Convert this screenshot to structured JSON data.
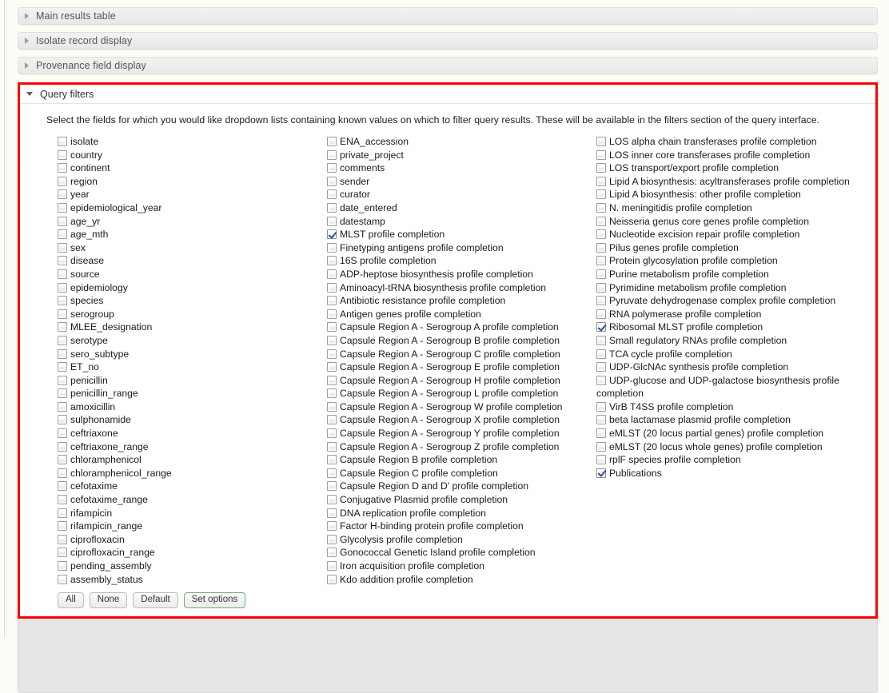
{
  "accordion": {
    "collapsed_sections": [
      {
        "label": "Main results table",
        "icon": "triangle-right-icon"
      },
      {
        "label": "Isolate record display",
        "icon": "triangle-right-icon"
      },
      {
        "label": "Provenance field display",
        "icon": "triangle-right-icon"
      }
    ],
    "expanded_section": {
      "label": "Query filters",
      "icon": "triangle-down-icon",
      "description": "Select the fields for which you would like dropdown lists containing known values on which to filter query results. These will be available in the filters section of the query interface.",
      "highlight_color": "#ff0000"
    }
  },
  "checkbox_columns": [
    {
      "name": "provenance-fields-column",
      "items": [
        {
          "label": "isolate",
          "checked": false
        },
        {
          "label": "country",
          "checked": false
        },
        {
          "label": "continent",
          "checked": false
        },
        {
          "label": "region",
          "checked": false
        },
        {
          "label": "year",
          "checked": false
        },
        {
          "label": "epidemiological_year",
          "checked": false
        },
        {
          "label": "age_yr",
          "checked": false
        },
        {
          "label": "age_mth",
          "checked": false
        },
        {
          "label": "sex",
          "checked": false
        },
        {
          "label": "disease",
          "checked": false
        },
        {
          "label": "source",
          "checked": false
        },
        {
          "label": "epidemiology",
          "checked": false
        },
        {
          "label": "species",
          "checked": false
        },
        {
          "label": "serogroup",
          "checked": false
        },
        {
          "label": "MLEE_designation",
          "checked": false
        },
        {
          "label": "serotype",
          "checked": false
        },
        {
          "label": "sero_subtype",
          "checked": false
        },
        {
          "label": "ET_no",
          "checked": false
        },
        {
          "label": "penicillin",
          "checked": false
        },
        {
          "label": "penicillin_range",
          "checked": false
        },
        {
          "label": "amoxicillin",
          "checked": false
        },
        {
          "label": "sulphonamide",
          "checked": false
        },
        {
          "label": "ceftriaxone",
          "checked": false
        },
        {
          "label": "ceftriaxone_range",
          "checked": false
        },
        {
          "label": "chloramphenicol",
          "checked": false
        },
        {
          "label": "chloramphenicol_range",
          "checked": false
        },
        {
          "label": "cefotaxime",
          "checked": false
        },
        {
          "label": "cefotaxime_range",
          "checked": false
        },
        {
          "label": "rifampicin",
          "checked": false
        },
        {
          "label": "rifampicin_range",
          "checked": false
        },
        {
          "label": "ciprofloxacin",
          "checked": false
        },
        {
          "label": "ciprofloxacin_range",
          "checked": false
        },
        {
          "label": "pending_assembly",
          "checked": false
        },
        {
          "label": "assembly_status",
          "checked": false
        }
      ]
    },
    {
      "name": "scheme-fields-column-a",
      "items": [
        {
          "label": "ENA_accession",
          "checked": false
        },
        {
          "label": "private_project",
          "checked": false
        },
        {
          "label": "comments",
          "checked": false
        },
        {
          "label": "sender",
          "checked": false
        },
        {
          "label": "curator",
          "checked": false
        },
        {
          "label": "date_entered",
          "checked": false
        },
        {
          "label": "datestamp",
          "checked": false
        },
        {
          "label": "MLST profile completion",
          "checked": true
        },
        {
          "label": "Finetyping antigens profile completion",
          "checked": false
        },
        {
          "label": "16S profile completion",
          "checked": false
        },
        {
          "label": "ADP-heptose biosynthesis profile completion",
          "checked": false
        },
        {
          "label": "Aminoacyl-tRNA biosynthesis profile completion",
          "checked": false
        },
        {
          "label": "Antibiotic resistance profile completion",
          "checked": false
        },
        {
          "label": "Antigen genes profile completion",
          "checked": false
        },
        {
          "label": "Capsule Region A - Serogroup A profile completion",
          "checked": false
        },
        {
          "label": "Capsule Region A - Serogroup B profile completion",
          "checked": false
        },
        {
          "label": "Capsule Region A - Serogroup C profile completion",
          "checked": false
        },
        {
          "label": "Capsule Region A - Serogroup E profile completion",
          "checked": false
        },
        {
          "label": "Capsule Region A - Serogroup H profile completion",
          "checked": false
        },
        {
          "label": "Capsule Region A - Serogroup L profile completion",
          "checked": false
        },
        {
          "label": "Capsule Region A - Serogroup W profile completion",
          "checked": false
        },
        {
          "label": "Capsule Region A - Serogroup X profile completion",
          "checked": false
        },
        {
          "label": "Capsule Region A - Serogroup Y profile completion",
          "checked": false
        },
        {
          "label": "Capsule Region A - Serogroup Z profile completion",
          "checked": false
        },
        {
          "label": "Capsule Region B profile completion",
          "checked": false
        },
        {
          "label": "Capsule Region C profile completion",
          "checked": false
        },
        {
          "label": "Capsule Region D and D' profile completion",
          "checked": false
        },
        {
          "label": "Conjugative Plasmid profile completion",
          "checked": false
        },
        {
          "label": "DNA replication profile completion",
          "checked": false
        },
        {
          "label": "Factor H-binding protein profile completion",
          "checked": false
        },
        {
          "label": "Glycolysis profile completion",
          "checked": false
        },
        {
          "label": "Gonococcal Genetic Island profile completion",
          "checked": false
        },
        {
          "label": "Iron acquisition profile completion",
          "checked": false
        },
        {
          "label": "Kdo addition profile completion",
          "checked": false
        }
      ]
    },
    {
      "name": "scheme-fields-column-b",
      "items": [
        {
          "label": "LOS alpha chain transferases profile completion",
          "checked": false
        },
        {
          "label": "LOS inner core transferases profile completion",
          "checked": false
        },
        {
          "label": "LOS transport/export profile completion",
          "checked": false
        },
        {
          "label": "Lipid A biosynthesis: acyltransferases profile completion",
          "checked": false
        },
        {
          "label": "Lipid A biosynthesis: other profile completion",
          "checked": false
        },
        {
          "label": "N. meningitidis profile completion",
          "checked": false
        },
        {
          "label": "Neisseria genus core genes profile completion",
          "checked": false
        },
        {
          "label": "Nucleotide excision repair profile completion",
          "checked": false
        },
        {
          "label": "Pilus genes profile completion",
          "checked": false
        },
        {
          "label": "Protein glycosylation profile completion",
          "checked": false
        },
        {
          "label": "Purine metabolism profile completion",
          "checked": false
        },
        {
          "label": "Pyrimidine metabolism profile completion",
          "checked": false
        },
        {
          "label": "Pyruvate dehydrogenase complex profile completion",
          "checked": false
        },
        {
          "label": "RNA polymerase profile completion",
          "checked": false
        },
        {
          "label": "Ribosomal MLST profile completion",
          "checked": true
        },
        {
          "label": "Small regulatory RNAs profile completion",
          "checked": false
        },
        {
          "label": "TCA cycle profile completion",
          "checked": false
        },
        {
          "label": "UDP-GlcNAc synthesis profile completion",
          "checked": false
        },
        {
          "label": "UDP-glucose and UDP-galactose biosynthesis profile completion",
          "checked": false
        },
        {
          "label": "VirB T4SS profile completion",
          "checked": false
        },
        {
          "label": "beta lactamase plasmid profile completion",
          "checked": false
        },
        {
          "label": "eMLST (20 locus partial genes) profile completion",
          "checked": false
        },
        {
          "label": "eMLST (20 locus whole genes) profile completion",
          "checked": false
        },
        {
          "label": "rplF species profile completion",
          "checked": false
        },
        {
          "label": "Publications",
          "checked": true
        }
      ]
    }
  ],
  "buttons": [
    {
      "label": "All",
      "name": "select-all-button",
      "accent": false
    },
    {
      "label": "None",
      "name": "select-none-button",
      "accent": false
    },
    {
      "label": "Default",
      "name": "select-default-button",
      "accent": false
    },
    {
      "label": "Set options",
      "name": "set-options-button",
      "accent": true
    }
  ]
}
